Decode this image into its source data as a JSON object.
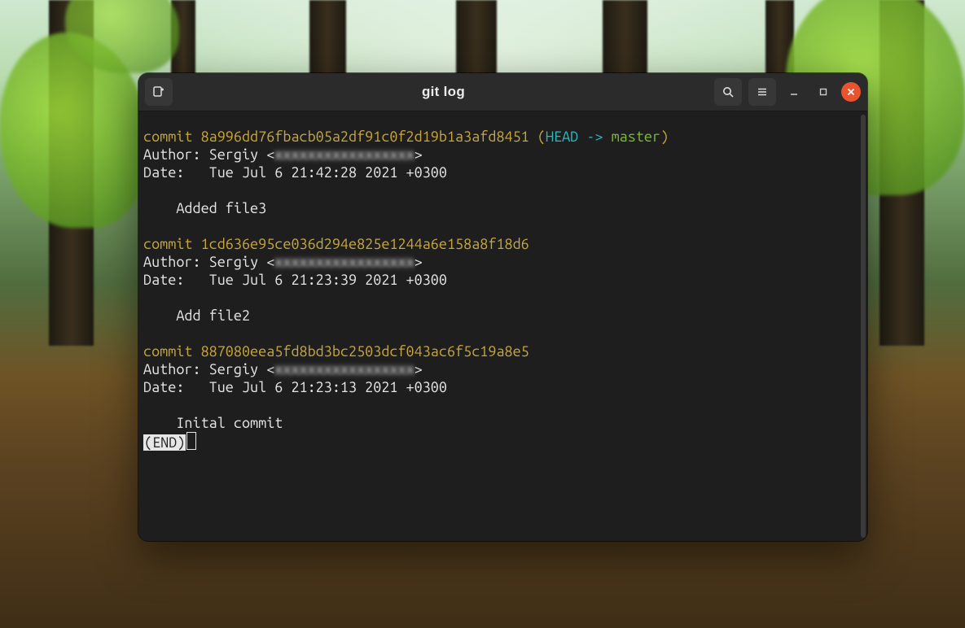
{
  "window": {
    "title": "git log"
  },
  "log": {
    "commits": [
      {
        "hash": "8a996dd76fbacb05a2df91c0f2d19b1a3afd8451",
        "ref_head": "HEAD -> ",
        "ref_branch": "master",
        "author_name": "Sergiy",
        "author_email_masked": "xxxxxxxxxxxxxxxxx",
        "date": "Tue Jul 6 21:42:28 2021 +0300",
        "message": "Added file3"
      },
      {
        "hash": "1cd636e95ce036d294e825e1244a6e158a8f18d6",
        "author_name": "Sergiy",
        "author_email_masked": "xxxxxxxxxxxxxxxxx",
        "date": "Tue Jul 6 21:23:39 2021 +0300",
        "message": "Add file2"
      },
      {
        "hash": "887080eea5fd8bd3bc2503dcf043ac6f5c19a8e5",
        "author_name": "Sergiy",
        "author_email_masked": "xxxxxxxxxxxxxxxxx",
        "date": "Tue Jul 6 21:23:13 2021 +0300",
        "message": "Inital commit"
      }
    ],
    "labels": {
      "commit": "commit ",
      "author": "Author: ",
      "date": "Date:   ",
      "indent": "    ",
      "end": "(END)"
    }
  }
}
